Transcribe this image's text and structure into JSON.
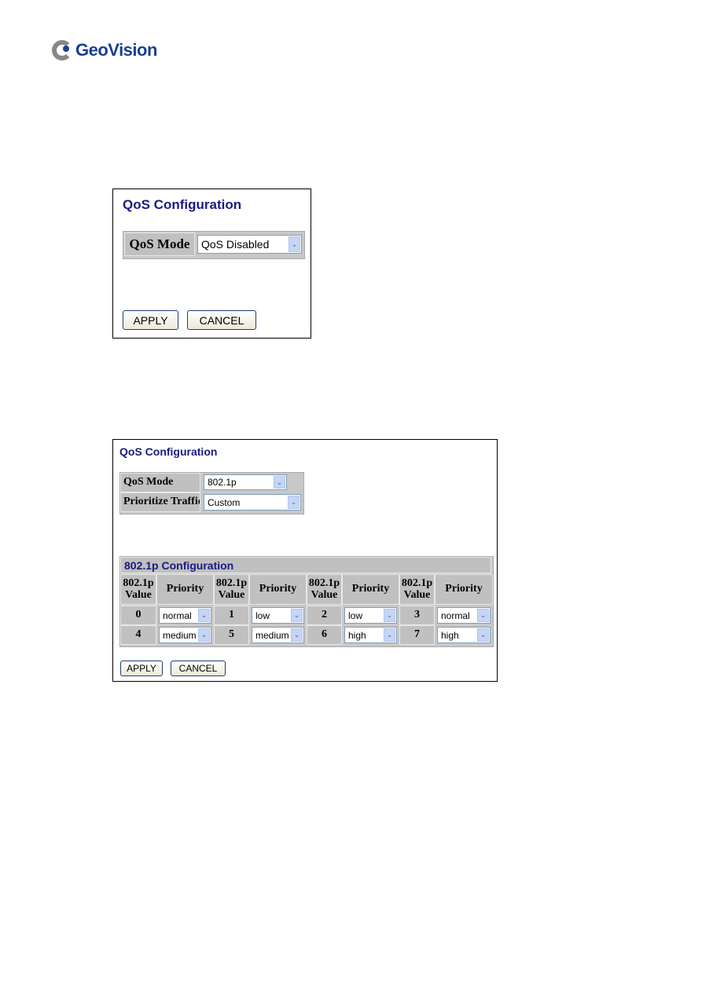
{
  "logo": {
    "brand": "GeoVision"
  },
  "panel1": {
    "title": "QoS Configuration",
    "qos_mode_label": "QoS Mode",
    "qos_mode_value": "QoS Disabled",
    "apply": "APPLY",
    "cancel": "CANCEL"
  },
  "panel2": {
    "title": "QoS Configuration",
    "qos_mode_label": "QoS Mode",
    "qos_mode_value": "802.1p",
    "prioritize_label": "Prioritize Traffic",
    "prioritize_value": "Custom",
    "config_title": "802.1p Configuration",
    "col_value": "802.1p Value",
    "col_priority": "Priority",
    "mappings": [
      {
        "value": "0",
        "priority": "normal"
      },
      {
        "value": "1",
        "priority": "low"
      },
      {
        "value": "2",
        "priority": "low"
      },
      {
        "value": "3",
        "priority": "normal"
      },
      {
        "value": "4",
        "priority": "medium"
      },
      {
        "value": "5",
        "priority": "medium"
      },
      {
        "value": "6",
        "priority": "high"
      },
      {
        "value": "7",
        "priority": "high"
      }
    ],
    "apply": "APPLY",
    "cancel": "CANCEL"
  },
  "icons": {
    "dropdown": "chevron-down-icon"
  },
  "colors": {
    "title": "#1a1a80",
    "cell": "#c0c0c0"
  }
}
